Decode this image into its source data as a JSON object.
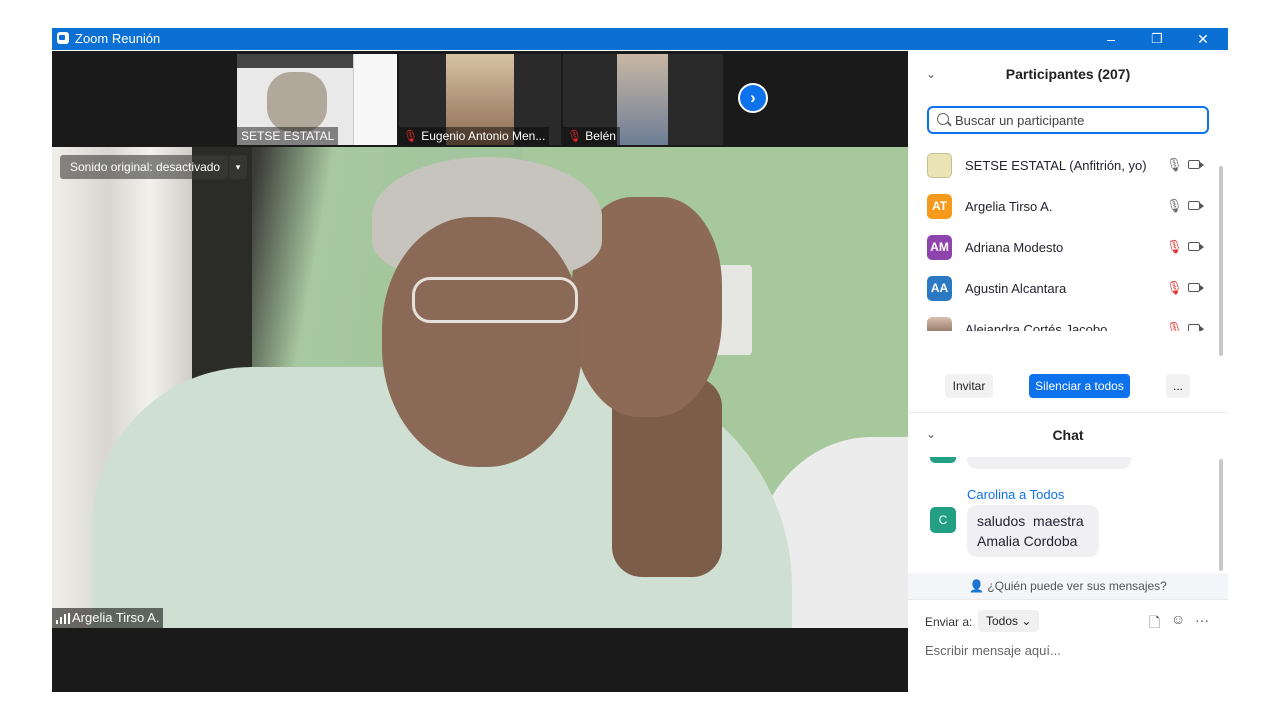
{
  "window": {
    "title": "Zoom Reunión",
    "minimize": "–",
    "restore": "❐",
    "close": "✕",
    "accent": "#0b6fd3"
  },
  "gallery": {
    "thumbs": [
      {
        "name": "SETSE ESTATAL",
        "muted": false
      },
      {
        "name": "Eugenio Antonio Men...",
        "muted": true
      },
      {
        "name": "Belén",
        "muted": true
      }
    ],
    "next": "›"
  },
  "main_video": {
    "audio_toggle": "Sonido original: desactivado",
    "audio_dropdown": "▾",
    "speaker": "Argelia Tirso A."
  },
  "participants": {
    "title": "Participantes (207)",
    "collapse": "⌄",
    "search_placeholder": "Buscar un participante",
    "list": [
      {
        "initials": "",
        "name": "SETSE ESTATAL (Anfitrión, yo)",
        "color": "#e9e3b6",
        "mic": "🎙",
        "muted": false
      },
      {
        "initials": "AT",
        "name": "Argelia Tirso A.",
        "color": "#f59a1b",
        "mic": "🎙",
        "muted": false
      },
      {
        "initials": "AM",
        "name": "Adriana Modesto",
        "color": "#8e44ad",
        "mic": "🎙",
        "muted": true
      },
      {
        "initials": "AA",
        "name": "Agustin Alcantara",
        "color": "#2b79c2",
        "mic": "🎙",
        "muted": true
      },
      {
        "initials": "",
        "name": "Alejandra Cortés Jacobo",
        "color": "#6b4a3c",
        "mic": "🎙",
        "muted": true
      }
    ],
    "invite": "Invitar",
    "mute_all": "Silenciar a todos",
    "more": "..."
  },
  "chat": {
    "title": "Chat",
    "collapse": "⌄",
    "message": {
      "sender": "Carolina a Todos",
      "avatar": "C",
      "text_line1": "saludos  maestra",
      "text_line2": "Amalia Cordoba"
    },
    "who_can_see": "¿Quién puede ver sus mensajes?",
    "send_to_label": "Enviar a:",
    "send_to_value": "Todos ⌄",
    "compose_placeholder": "Escribir mensaje aquí...",
    "icons": {
      "file": "🗋",
      "emoji": "☺",
      "more": "···"
    }
  }
}
